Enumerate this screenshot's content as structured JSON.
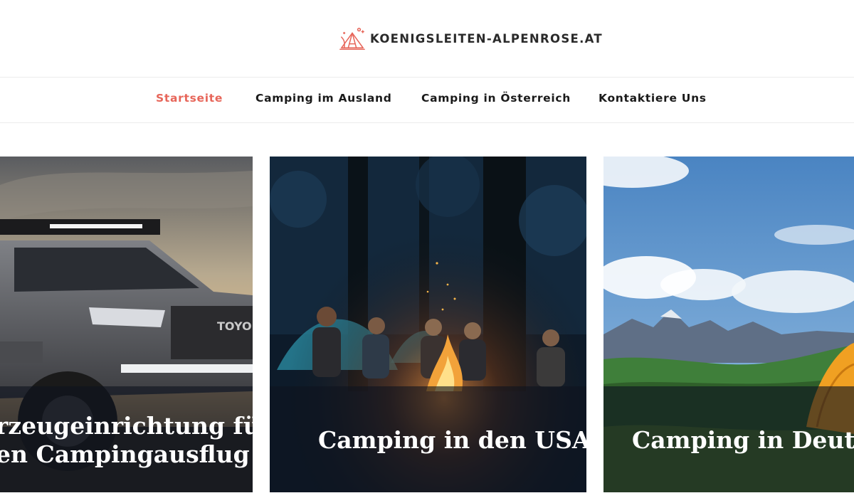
{
  "brand": {
    "name": "KOENIGSLEITEN-ALPENROSE.AT",
    "logo_icon": "camping-tent-icon",
    "logo_color": "#e7665a"
  },
  "nav": {
    "items": [
      {
        "label": "Startseite",
        "active": true
      },
      {
        "label": "Camping im Ausland",
        "active": false
      },
      {
        "label": "Camping in Österreich",
        "active": false
      },
      {
        "label": "Kontaktiere Uns",
        "active": false
      }
    ],
    "active_color": "#e7665a"
  },
  "cards": [
    {
      "caption_line1": "rzeugeinrichtung für",
      "caption_line2": "en Campingausflug",
      "image": "offroad-truck-sunset-photo"
    },
    {
      "caption_line1": "Camping in den USA",
      "image": "campfire-night-forest-photo"
    },
    {
      "caption_line1": "Camping in Deutschla",
      "image": "mountain-meadow-tent-photo"
    }
  ]
}
